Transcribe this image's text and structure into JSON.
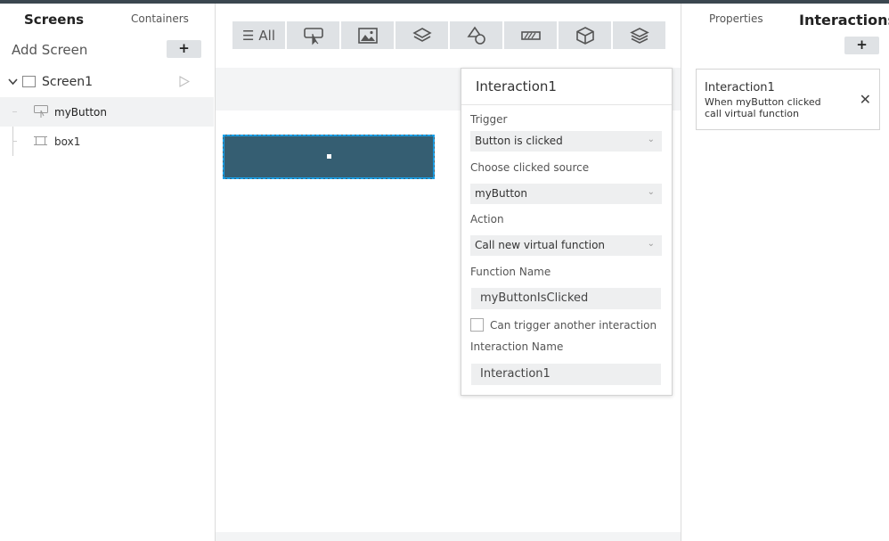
{
  "left_panel": {
    "tabs": [
      "Screens",
      "Containers"
    ],
    "add_screen_label": "Add Screen",
    "add_button_label": "+",
    "tree": {
      "screen_label": "Screen1",
      "children": [
        "myButton",
        "box1"
      ]
    }
  },
  "toolbar": {
    "all_label": "All",
    "icons": [
      "button-icon",
      "image-icon",
      "layers-icon",
      "shapes-icon",
      "slider-icon",
      "cube-icon",
      "stack-icon"
    ]
  },
  "popup": {
    "title": "Interaction1",
    "trigger_label": "Trigger",
    "trigger_value": "Button is clicked",
    "source_label": "Choose clicked source",
    "source_value": "myButton",
    "action_label": "Action",
    "action_value": "Call new virtual function",
    "function_name_label": "Function Name",
    "function_name_value": "myButtonIsClicked",
    "checkbox_label": "Can trigger another interaction",
    "interaction_name_label": "Interaction Name",
    "interaction_name_value": "Interaction1"
  },
  "right_panel": {
    "tabs": [
      "Properties",
      "Interactions"
    ],
    "add_button_label": "+",
    "card": {
      "title": "Interaction1",
      "description": "When myButton clicked call virtual function",
      "close_glyph": "✕"
    }
  },
  "colors": {
    "canvas_button": "#355e72",
    "selection_outline": "#1aa0e8",
    "toolbar_bg": "#dfe2e5"
  }
}
